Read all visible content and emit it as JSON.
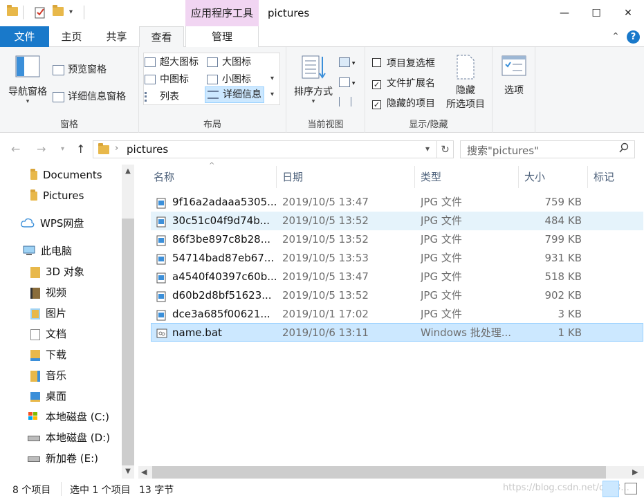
{
  "window": {
    "title": "pictures",
    "context_tools_label": "应用程序工具",
    "minimize_glyph": "—",
    "maximize_glyph": "☐",
    "close_glyph": "✕"
  },
  "ribbon_tabs": {
    "file": "文件",
    "home": "主页",
    "share": "共享",
    "view": "查看",
    "manage": "管理",
    "collapse_glyph": "⌃",
    "help_glyph": "?"
  },
  "ribbon": {
    "panes": {
      "label": "窗格",
      "nav_pane": "导航窗格",
      "preview_pane": "预览窗格",
      "details_pane": "详细信息窗格"
    },
    "layout": {
      "label": "布局",
      "extra_large": "超大图标",
      "large": "大图标",
      "medium": "中图标",
      "small": "小图标",
      "list": "列表",
      "details": "详细信息"
    },
    "current_view": {
      "label": "当前视图",
      "sort_by": "排序方式"
    },
    "show_hide": {
      "label": "显示/隐藏",
      "item_checkboxes": "项目复选框",
      "item_checkboxes_checked": false,
      "file_extensions": "文件扩展名",
      "file_extensions_checked": true,
      "hidden_items": "隐藏的项目",
      "hidden_items_checked": true,
      "hide_selected_line1": "隐藏",
      "hide_selected_line2": "所选项目",
      "options": "选项"
    }
  },
  "address": {
    "path": "pictures",
    "search_placeholder": "搜索\"pictures\""
  },
  "nav_pane": {
    "items": [
      {
        "label": "Documents",
        "icon": "folder-icon"
      },
      {
        "label": "Pictures",
        "icon": "folder-icon"
      },
      {
        "label": "WPS网盘",
        "icon": "cloud-icon"
      },
      {
        "label": "此电脑",
        "icon": "computer-icon"
      },
      {
        "label": "3D 对象",
        "icon": "3d-objects-icon"
      },
      {
        "label": "视频",
        "icon": "videos-icon"
      },
      {
        "label": "图片",
        "icon": "pictures-icon"
      },
      {
        "label": "文档",
        "icon": "documents-icon"
      },
      {
        "label": "下载",
        "icon": "downloads-icon"
      },
      {
        "label": "音乐",
        "icon": "music-icon"
      },
      {
        "label": "桌面",
        "icon": "desktop-icon"
      },
      {
        "label": "本地磁盘 (C:)",
        "icon": "drive-c-icon"
      },
      {
        "label": "本地磁盘 (D:)",
        "icon": "drive-icon"
      },
      {
        "label": "新加卷 (E:)",
        "icon": "drive-icon"
      }
    ]
  },
  "file_list": {
    "columns": [
      "名称",
      "日期",
      "类型",
      "大小",
      "标记"
    ],
    "rows": [
      {
        "name": "9f16a2adaaa5305...",
        "date": "2019/10/5 13:47",
        "type": "JPG 文件",
        "size": "759 KB"
      },
      {
        "name": "30c51c04f9d74b...",
        "date": "2019/10/5 13:52",
        "type": "JPG 文件",
        "size": "484 KB"
      },
      {
        "name": "86f3be897c8b28...",
        "date": "2019/10/5 13:52",
        "type": "JPG 文件",
        "size": "799 KB"
      },
      {
        "name": "54714bad87eb67...",
        "date": "2019/10/5 13:53",
        "type": "JPG 文件",
        "size": "931 KB"
      },
      {
        "name": "a4540f40397c60b...",
        "date": "2019/10/5 13:47",
        "type": "JPG 文件",
        "size": "518 KB"
      },
      {
        "name": "d60b2d8bf51623...",
        "date": "2019/10/5 13:52",
        "type": "JPG 文件",
        "size": "902 KB"
      },
      {
        "name": "dce3a685f00621...",
        "date": "2019/10/1 17:02",
        "type": "JPG 文件",
        "size": "3 KB"
      },
      {
        "name": "name.bat",
        "date": "2019/10/6 13:11",
        "type": "Windows 批处理...",
        "size": "1 KB"
      }
    ]
  },
  "status_bar": {
    "item_count": "8 个项目",
    "selection": "选中 1 个项目",
    "selection_size": "13 字节",
    "watermark": "https://blog.csdn.net/qq_3..."
  }
}
